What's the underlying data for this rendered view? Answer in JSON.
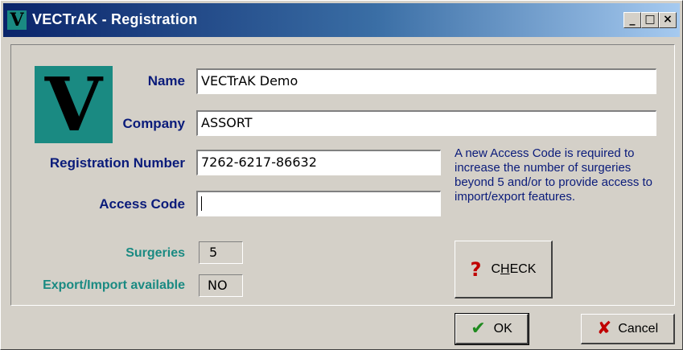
{
  "window": {
    "icon_letter": "V",
    "title": "VECTrAK - Registration",
    "minimize_glyph": "_",
    "maximize_glyph": "□",
    "close_glyph": "×"
  },
  "logo": {
    "letter": "V",
    "color": "#1a8a82"
  },
  "form": {
    "name_label": "Name",
    "name_value": "VECTrAK Demo",
    "company_label": "Company",
    "company_value": "ASSORT",
    "regnum_label": "Registration Number",
    "regnum_value": "7262-6217-86632",
    "access_label": "Access Code",
    "access_value": "",
    "surgeries_label": "Surgeries",
    "surgeries_value": "5",
    "export_label": "Export/Import available",
    "export_value": "NO"
  },
  "info_text": "A new Access Code is required to increase the number of surgeries beyond 5 and/or to provide access to import/export features.",
  "buttons": {
    "check": {
      "icon": "question-mark-icon",
      "pre": "C",
      "underlined": "H",
      "post": "ECK"
    },
    "ok": {
      "icon": "checkmark-icon",
      "label": "OK"
    },
    "cancel": {
      "icon": "x-cross-icon",
      "label": "Cancel"
    }
  },
  "colors": {
    "title_bar_start": "#0a246a",
    "title_bar_end": "#a6caf0",
    "label_navy": "#0a1b7a",
    "label_teal": "#1a8a82",
    "dialog_face": "#d4d0c8"
  }
}
